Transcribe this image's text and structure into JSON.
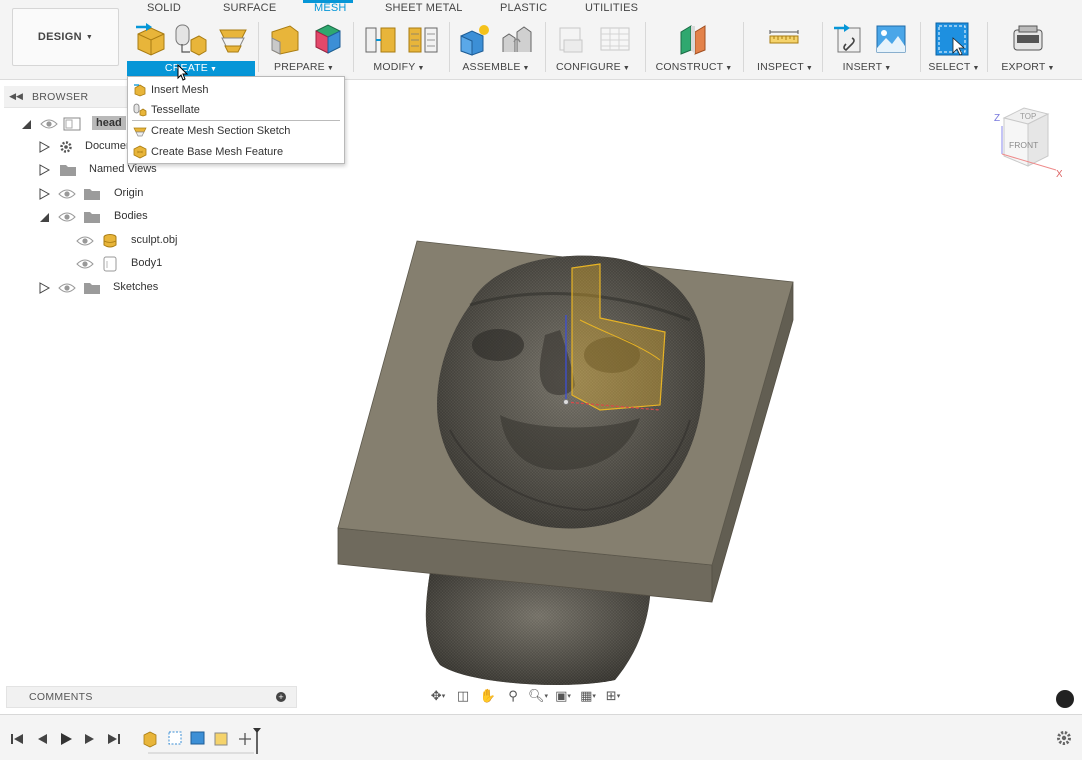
{
  "workspace": {
    "label": "DESIGN"
  },
  "tabs": [
    {
      "label": "SOLID",
      "active": false
    },
    {
      "label": "SURFACE",
      "active": false
    },
    {
      "label": "MESH",
      "active": true
    },
    {
      "label": "SHEET METAL",
      "active": false
    },
    {
      "label": "PLASTIC",
      "active": false
    },
    {
      "label": "UTILITIES",
      "active": false
    }
  ],
  "tool_groups": [
    {
      "label": "CREATE",
      "active": true
    },
    {
      "label": "PREPARE"
    },
    {
      "label": "MODIFY"
    },
    {
      "label": "ASSEMBLE"
    },
    {
      "label": "CONFIGURE"
    },
    {
      "label": "CONSTRUCT"
    },
    {
      "label": "INSPECT"
    },
    {
      "label": "INSERT"
    },
    {
      "label": "SELECT"
    },
    {
      "label": "EXPORT"
    }
  ],
  "create_menu": {
    "items": [
      {
        "label": "Insert Mesh",
        "icon": "insert-mesh-icon"
      },
      {
        "label": "Tessellate",
        "icon": "tessellate-icon"
      },
      {
        "label": "Create Mesh Section Sketch",
        "icon": "mesh-section-sketch-icon"
      },
      {
        "label": "Create Base Mesh Feature",
        "icon": "base-mesh-feature-icon"
      }
    ]
  },
  "browser": {
    "title": "BROWSER",
    "tree": [
      {
        "label": "head",
        "expanded": true,
        "highlighted": true
      },
      {
        "label": "Document Settings"
      },
      {
        "label": "Named Views"
      },
      {
        "label": "Origin"
      },
      {
        "label": "Bodies",
        "expanded": true
      },
      {
        "label": "sculpt.obj"
      },
      {
        "label": "Body1"
      },
      {
        "label": "Sketches"
      }
    ]
  },
  "viewcube": {
    "top": "TOP",
    "front": "FRONT",
    "axis_x": "X",
    "axis_z": "Z"
  },
  "comments": {
    "title": "COMMENTS"
  },
  "colors": {
    "accent": "#0696d7",
    "block": "#7b7566",
    "mesh": "#55524b",
    "highlight": "#e7b325"
  }
}
